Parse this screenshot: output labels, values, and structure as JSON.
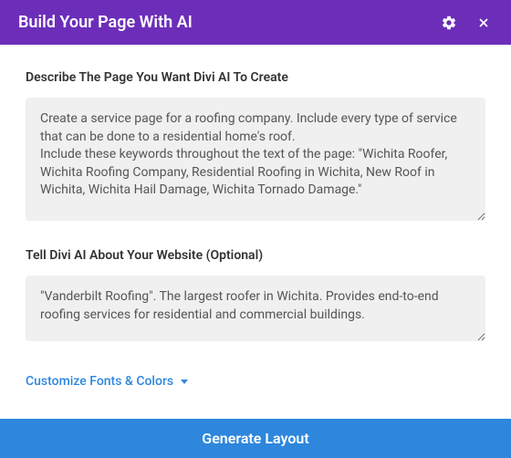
{
  "header": {
    "title": "Build Your Page With AI"
  },
  "describe": {
    "label": "Describe The Page You Want Divi AI To Create",
    "value": "Create a service page for a roofing company. Include every type of service that can be done to a residential home's roof.\nInclude these keywords throughout the text of the page: \"Wichita Roofer, Wichita Roofing Company, Residential Roofing in Wichita, New Roof in Wichita, Wichita Hail Damage, Wichita Tornado Damage.\""
  },
  "about": {
    "label": "Tell Divi AI About Your Website (Optional)",
    "value": "\"Vanderbilt Roofing\". The largest roofer in Wichita. Provides end-to-end roofing services for residential and commercial buildings."
  },
  "customize": {
    "label": "Customize Fonts & Colors"
  },
  "generate": {
    "label": "Generate Layout"
  }
}
